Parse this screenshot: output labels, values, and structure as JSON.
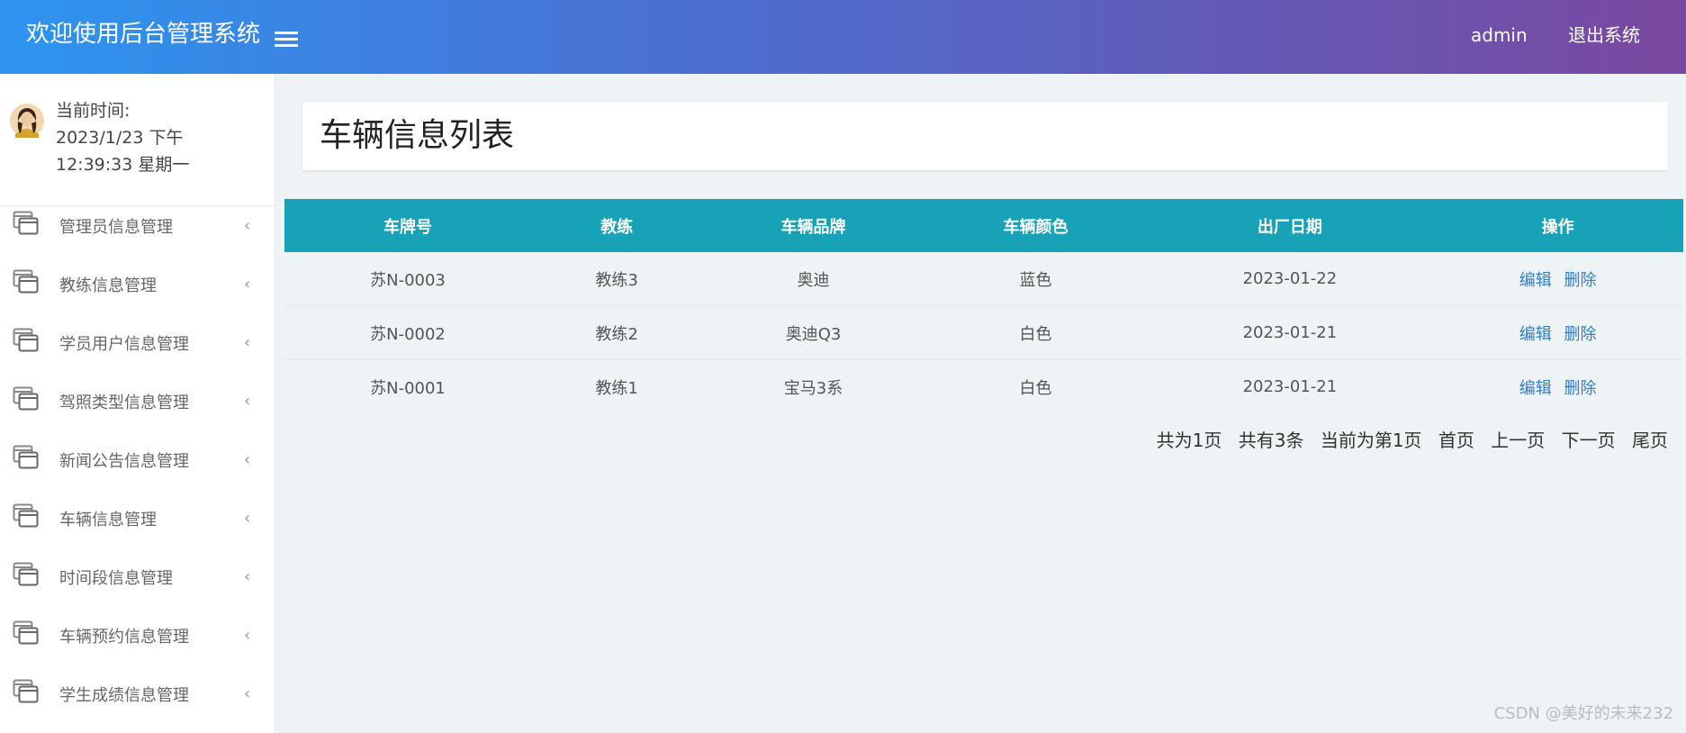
{
  "header": {
    "title": "欢迎使用后台管理系统",
    "user": "admin",
    "logout": "退出系统"
  },
  "profile": {
    "time_label": "当前时间:",
    "time_line1": "2023/1/23 下午",
    "time_line2": "12:39:33 星期一"
  },
  "sidebar": {
    "items": [
      {
        "label": "管理员信息管理"
      },
      {
        "label": "教练信息管理"
      },
      {
        "label": "学员用户信息管理"
      },
      {
        "label": "驾照类型信息管理"
      },
      {
        "label": "新闻公告信息管理"
      },
      {
        "label": "车辆信息管理"
      },
      {
        "label": "时间段信息管理"
      },
      {
        "label": "车辆预约信息管理"
      },
      {
        "label": "学生成绩信息管理"
      }
    ],
    "arrow": "‹"
  },
  "page": {
    "title": "车辆信息列表"
  },
  "table": {
    "headers": [
      "车牌号",
      "教练",
      "车辆品牌",
      "车辆颜色",
      "出厂日期",
      "操作"
    ],
    "rows": [
      {
        "plate": "苏N-0003",
        "coach": "教练3",
        "brand": "奥迪",
        "color": "蓝色",
        "date": "2023-01-22",
        "edit": "编辑",
        "delete": "删除"
      },
      {
        "plate": "苏N-0002",
        "coach": "教练2",
        "brand": "奥迪Q3",
        "color": "白色",
        "date": "2023-01-21",
        "edit": "编辑",
        "delete": "删除"
      },
      {
        "plate": "苏N-0001",
        "coach": "教练1",
        "brand": "宝马3系",
        "color": "白色",
        "date": "2023-01-21",
        "edit": "编辑",
        "delete": "删除"
      }
    ]
  },
  "pager": {
    "total_pages": "共为1页",
    "total_records": "共有3条",
    "current": "当前为第1页",
    "first": "首页",
    "prev": "上一页",
    "next": "下一页",
    "last": "尾页"
  },
  "watermark": "CSDN @美好的未来232",
  "colors": {
    "header_gradient_start": "#2d95f0",
    "header_gradient_end": "#7a48a0",
    "table_header": "#17a2b8",
    "link": "#2a7fd4",
    "background": "#eef3f6"
  },
  "icons": {
    "menu": "hamburger-menu-icon",
    "sidebar_item": "window-stack-icon",
    "avatar": "user-avatar"
  }
}
